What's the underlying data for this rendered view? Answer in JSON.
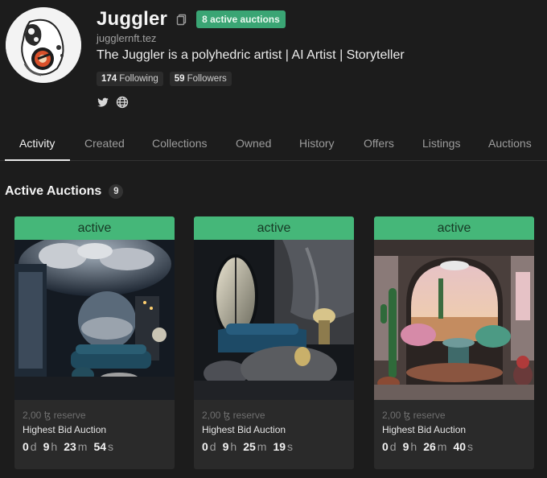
{
  "profile": {
    "name": "Juggler",
    "badge": "8 active auctions",
    "handle": "jugglernft.tez",
    "bio": "The Juggler is a polyhedric artist | AI Artist | Storyteller",
    "following_count": "174",
    "following_label": "Following",
    "followers_count": "59",
    "followers_label": "Followers",
    "social_icons": [
      "twitter-icon",
      "globe-icon"
    ]
  },
  "tabs": [
    "Activity",
    "Created",
    "Collections",
    "Owned",
    "History",
    "Offers",
    "Listings",
    "Auctions"
  ],
  "active_tab": "Activity",
  "section": {
    "title": "Active Auctions",
    "count": "9"
  },
  "cards": [
    {
      "status": "active",
      "reserve": "2,00",
      "reserve_label": "reserve",
      "auction_type": "Highest Bid Auction",
      "timer": {
        "d": "0",
        "h": "9",
        "m": "23",
        "s": "54"
      }
    },
    {
      "status": "active",
      "reserve": "2,00",
      "reserve_label": "reserve",
      "auction_type": "Highest Bid Auction",
      "timer": {
        "d": "0",
        "h": "9",
        "m": "25",
        "s": "19"
      }
    },
    {
      "status": "active",
      "reserve": "2,00",
      "reserve_label": "reserve",
      "auction_type": "Highest Bid Auction",
      "timer": {
        "d": "0",
        "h": "9",
        "m": "26",
        "s": "40"
      }
    }
  ],
  "units": {
    "d": "d",
    "h": "h",
    "m": "m",
    "s": "s"
  },
  "currency_symbol": "ꜩ",
  "colors": {
    "background": "#1c1c1c",
    "active_green": "#45b779",
    "badge_green": "#3aa574"
  }
}
